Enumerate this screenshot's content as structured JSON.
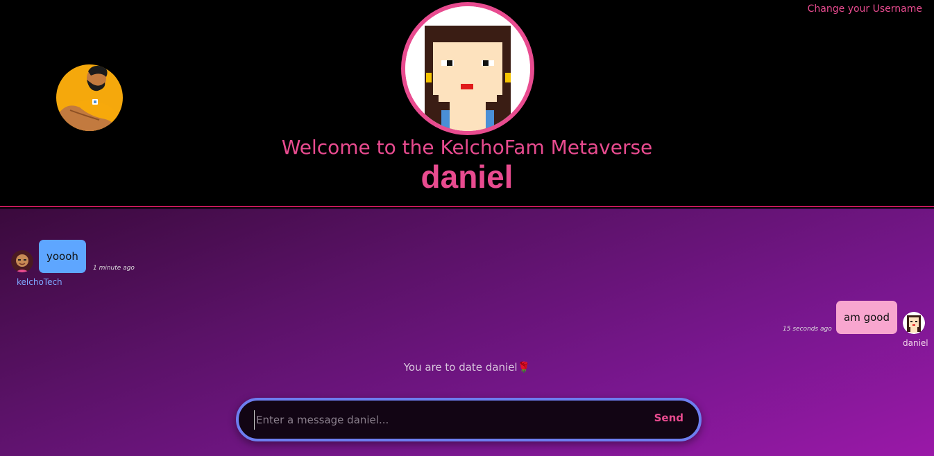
{
  "header": {
    "change_username_label": "Change your Username",
    "welcome_text": "Welcome to the KelchoFam Metaverse",
    "username": "daniel"
  },
  "messages": [
    {
      "side": "left",
      "text": "yoooh",
      "time": "1 minute ago",
      "sender": "kelchoTech",
      "bubble_color": "#5ea6ff",
      "avatar": "girl-avatar-icon"
    },
    {
      "side": "right",
      "text": "am good",
      "time": "15 seconds ago",
      "sender": "daniel",
      "bubble_color": "#f8a6cf",
      "avatar": "pixel-avatar-icon"
    }
  ],
  "notice": "You are to date daniel🌹",
  "composer": {
    "placeholder": "Enter a message daniel...",
    "send_label": "Send"
  },
  "colors": {
    "accent": "#e84b8f",
    "input_border": "#6d7ef0",
    "sender_left": "#7ea8ff",
    "sender_right": "#f2d6ea"
  }
}
